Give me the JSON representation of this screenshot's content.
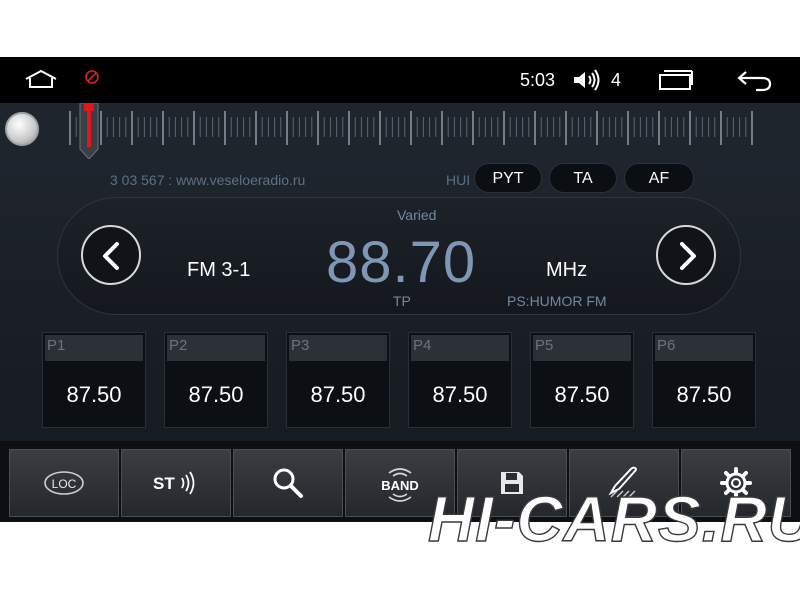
{
  "status_bar": {
    "time": "5:03",
    "volume_level": "4",
    "icons": [
      "home-icon",
      "no-entry-icon",
      "volume-icon",
      "recent-apps-icon",
      "back-icon"
    ]
  },
  "radio": {
    "radio_text": "3 03 567 : www.veseloeradio.ru",
    "hui_text": "HUI",
    "buttons": {
      "pty": "PYT",
      "ta": "TA",
      "af": "AF"
    },
    "program_type": "Varied",
    "band": "FM 3-1",
    "frequency": "88.70",
    "unit": "MHz",
    "tp": "TP",
    "ps": "PS:HUMOR FM",
    "presets": [
      {
        "label": "P1",
        "value": "87.50"
      },
      {
        "label": "P2",
        "value": "87.50"
      },
      {
        "label": "P3",
        "value": "87.50"
      },
      {
        "label": "P4",
        "value": "87.50"
      },
      {
        "label": "P5",
        "value": "87.50"
      },
      {
        "label": "P6",
        "value": "87.50"
      }
    ]
  },
  "toolbar": {
    "loc_label": "LOC",
    "st_label": "ST",
    "band_label": "BAND",
    "icons": [
      "loc-icon",
      "stereo-icon",
      "search-icon",
      "band-icon",
      "save-icon",
      "edit-icon",
      "settings-icon"
    ]
  },
  "watermark": "HI-CARS.RU",
  "colors": {
    "accent_frequency": "#7f97b4",
    "tuner_needle": "#e01818",
    "block_icon": "#e02020"
  }
}
